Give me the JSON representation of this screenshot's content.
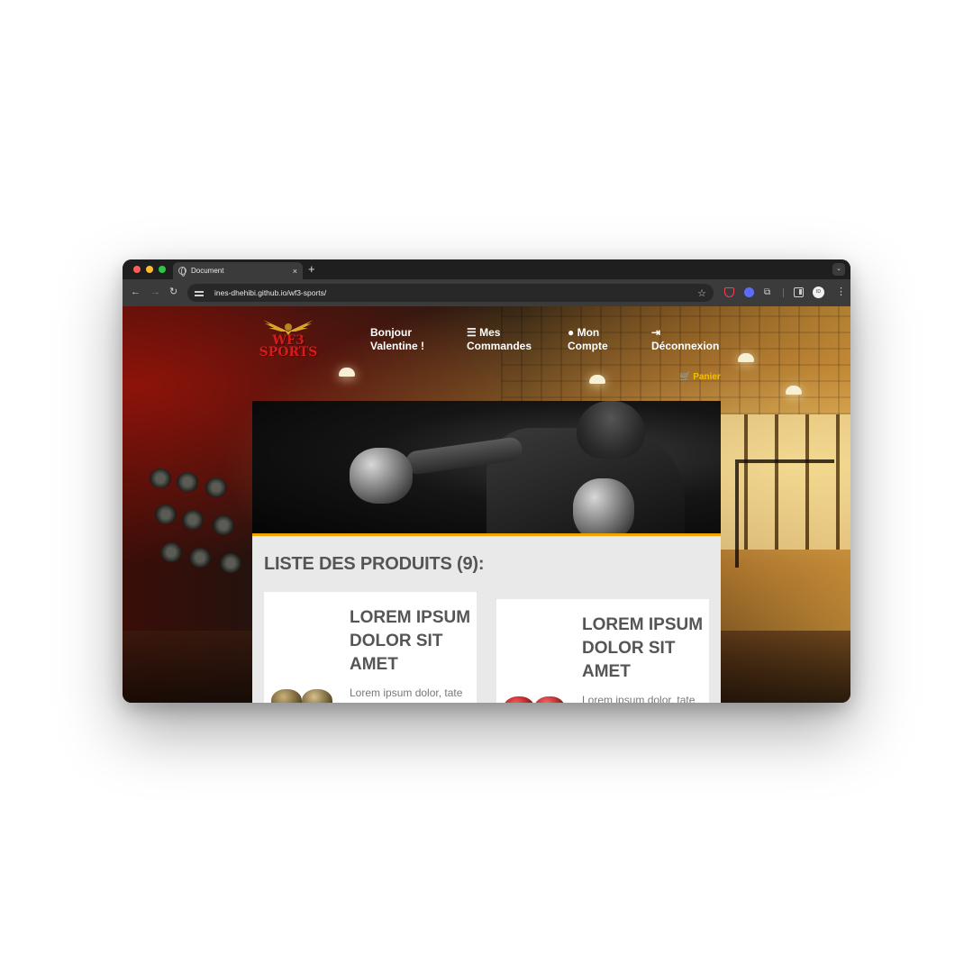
{
  "browser": {
    "tab_title": "Document",
    "tab_close": "×",
    "new_tab": "+",
    "tab_menu": "⌄",
    "url": "ines-dhehibi.github.io/wf3-sports/",
    "back": "←",
    "forward": "→",
    "reload": "↻",
    "bookmark": "☆",
    "extensions": "⧉",
    "menu": "⋮",
    "profile_initials": "ID"
  },
  "site": {
    "logo_text": "WF3 SPORTS",
    "nav": [
      {
        "icon": "",
        "label": "Bonjour Valentine !"
      },
      {
        "icon": "☰",
        "label": "Mes Commandes"
      },
      {
        "icon": "●",
        "label": "Mon Compte"
      },
      {
        "icon": "⇥",
        "label": "Déconnexion"
      }
    ],
    "cart_label": "🛒 Panier"
  },
  "products": {
    "title": "LISTE DES PRODUITS (9):",
    "items": [
      {
        "title": "LOREM IPSUM DOLOR SIT AMET",
        "text": "Lorem ipsum dolor, tate"
      },
      {
        "title": "LOREM IPSUM DOLOR SIT AMET",
        "text": "Lorem ipsum dolor, tate"
      }
    ]
  },
  "colors": {
    "accent": "#f0a400",
    "logo_red": "#d51c1c",
    "logo_gold": "#d9a62a"
  }
}
